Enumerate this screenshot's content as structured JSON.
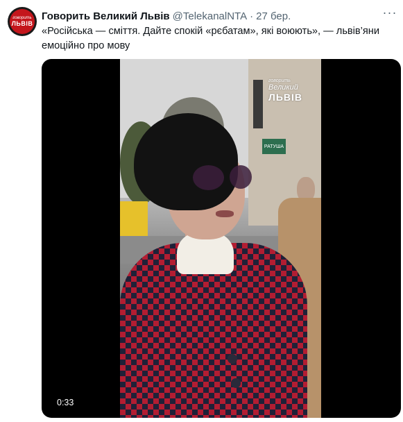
{
  "tweet": {
    "author_name": "Говорить Великий Львів",
    "author_handle": "@TelekanalNTA",
    "separator": "·",
    "timestamp": "27 бер.",
    "text": "«Російська — сміття. Дайте спокій «рєбатам», які воюють», — львів’яни емоційно про мову",
    "more_icon": "more-horizontal-icon"
  },
  "avatar": {
    "line1": "говорить",
    "line2": "ЛЬВІВ"
  },
  "video": {
    "duration": "0:33",
    "sign_text": "РАТУША",
    "watermark": {
      "line1": "говорить",
      "line2": "Великий",
      "line3": "ЛЬВІВ"
    }
  }
}
